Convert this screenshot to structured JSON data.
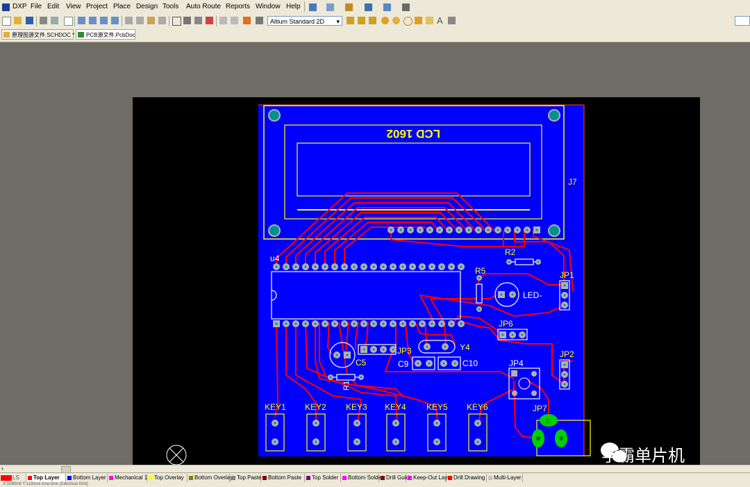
{
  "menubar": {
    "items": [
      "DXP",
      "File",
      "Edit",
      "View",
      "Project",
      "Place",
      "Design",
      "Tools",
      "Auto Route",
      "Reports",
      "Window",
      "Help"
    ]
  },
  "toolbar": {
    "view_select": "Altium Standard 2D"
  },
  "doc_tabs": [
    {
      "label": "原理图源文件.SCHDOC *",
      "icon": "schematic-doc-icon"
    },
    {
      "label": "PCB源文件.PcbDoc",
      "icon": "pcb-doc-icon"
    }
  ],
  "pcb": {
    "lcd_label": "LCD 1602",
    "labels": {
      "j7": "J7",
      "u4": "u4",
      "r2": "R2",
      "r5": "R5",
      "jp1": "JP1",
      "led": "LED-",
      "jp6": "JP6",
      "jp2": "JP2",
      "jp3": "JP3",
      "y4": "Y4",
      "c5": "C5",
      "c9": "C9",
      "c10": "C10",
      "jp4": "JP4",
      "r1": "R1",
      "jp7": "JP7",
      "key1": "KEY1",
      "key2": "KEY2",
      "key3": "KEY3",
      "key4": "KEY4",
      "key5": "KEY5",
      "key6": "KEY6",
      "pad2": "2"
    },
    "colors": {
      "board": "#0000ff",
      "trace": "#ff0000",
      "overlay": "#ffff00",
      "pad": "#b0b0b0",
      "via": "#009090"
    }
  },
  "layer_tabs": [
    {
      "label": "LS",
      "color": "#ff0000"
    },
    {
      "label": "Top Layer",
      "color": "#ff0000"
    },
    {
      "label": "Bottom Layer",
      "color": "#0000ff"
    },
    {
      "label": "Mechanical 1",
      "color": "#ff00ff"
    },
    {
      "label": "Top Overlay",
      "color": "#ffff00"
    },
    {
      "label": "Bottom Overlay",
      "color": "#808000"
    },
    {
      "label": "Top Paste",
      "color": "#808080"
    },
    {
      "label": "Bottom Paste",
      "color": "#800000"
    },
    {
      "label": "Top Solder",
      "color": "#800080"
    },
    {
      "label": "Bottom Solder",
      "color": "#ff00ff"
    },
    {
      "label": "Drill Guide",
      "color": "#800000"
    },
    {
      "label": "Keep-Out Layer",
      "color": "#ff00ff"
    },
    {
      "label": "Drill Drawing",
      "color": "#ff0000"
    },
    {
      "label": "Multi-Layer",
      "color": "#c0c0c0"
    }
  ],
  "status": {
    "text": "X:1080mil Y:1155mil Grid:5mil (Electrical Grid)"
  },
  "watermark": "学霸单片机"
}
